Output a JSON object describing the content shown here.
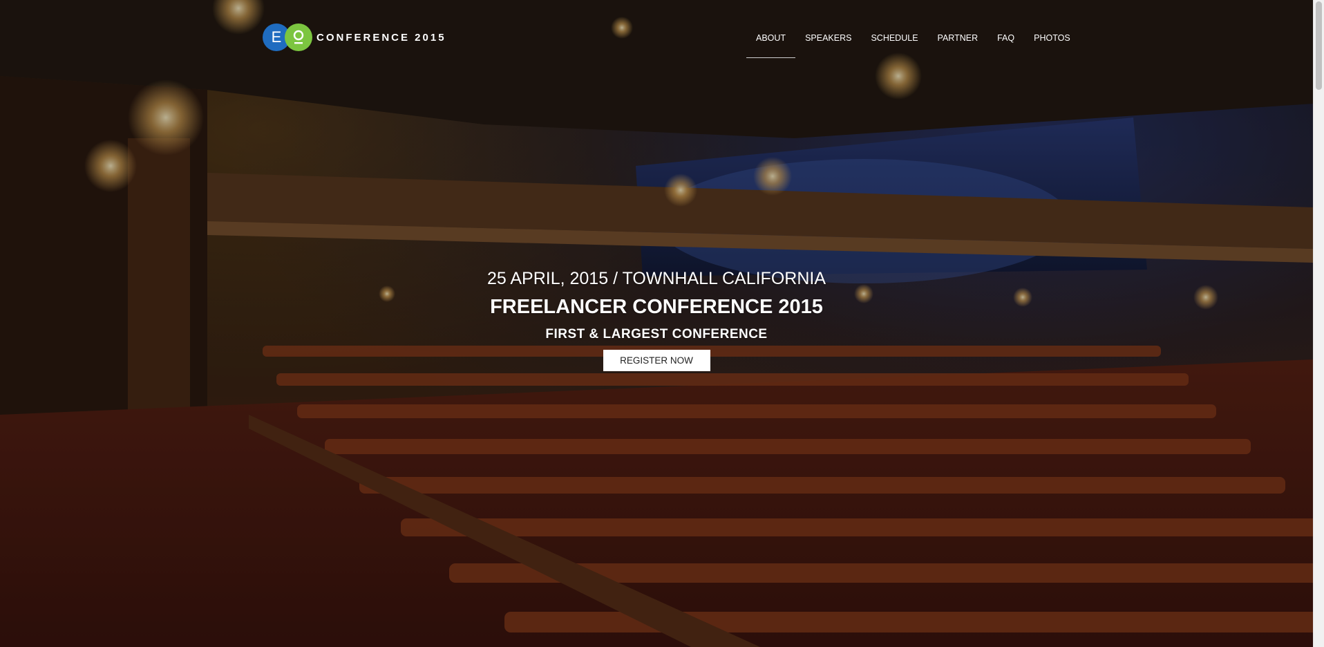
{
  "brand": {
    "logo_letter_left": "E",
    "logo_letter_right": "O",
    "name": "CONFERENCE 2015",
    "colors": {
      "blue": "#1f6cc0",
      "green": "#7cc540"
    }
  },
  "nav": {
    "items": [
      {
        "label": "ABOUT",
        "active": true
      },
      {
        "label": "SPEAKERS",
        "active": false
      },
      {
        "label": "SCHEDULE",
        "active": false
      },
      {
        "label": "PARTNER",
        "active": false
      },
      {
        "label": "FAQ",
        "active": false
      },
      {
        "label": "PHOTOS",
        "active": false
      }
    ]
  },
  "hero": {
    "date_location": "25 APRIL, 2015 / TOWNHALL CALIFORNIA",
    "title": "FREELANCER CONFERENCE 2015",
    "subtitle": "FIRST & LARGEST CONFERENCE",
    "cta_label": "REGISTER NOW"
  }
}
